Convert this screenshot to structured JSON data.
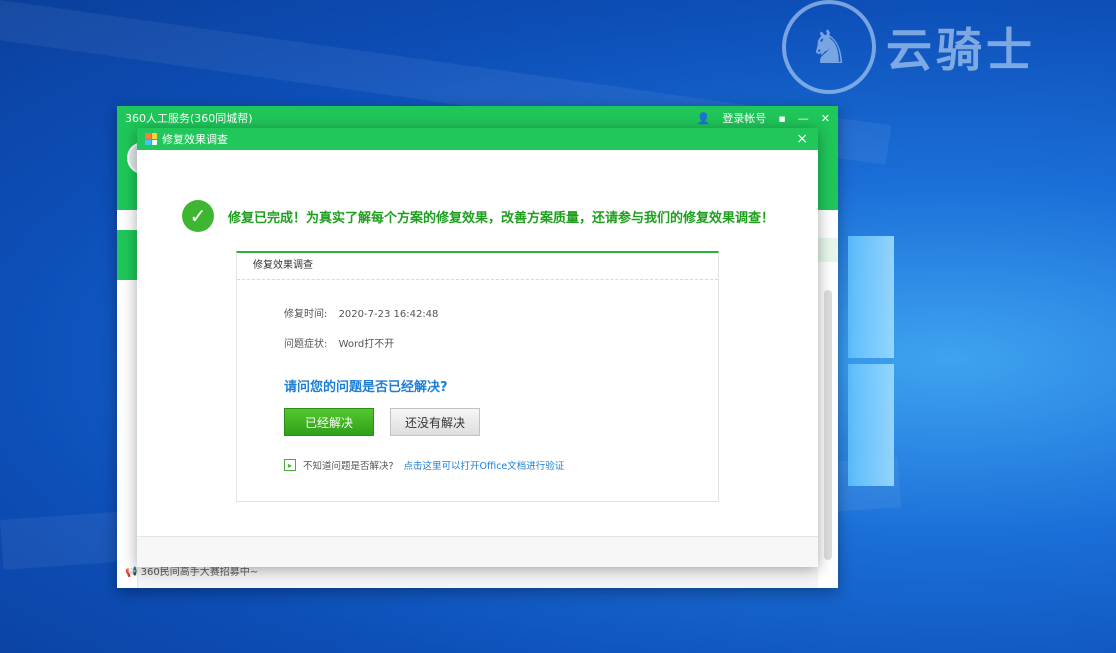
{
  "back_window": {
    "title": "360人工服务(360同城帮)",
    "login_label": "登录帐号",
    "footer_text": "360民间高手大赛招募中~"
  },
  "dialog": {
    "title": "修复效果调查",
    "close": "×",
    "headline": "修复已完成！为真实了解每个方案的修复效果，改善方案质量，还请参与我们的修复效果调查！",
    "card": {
      "header": "修复效果调查",
      "time_label": "修复时间:",
      "time_value": "2020-7-23 16:42:48",
      "symptom_label": "问题症状:",
      "symptom_value": "Word打不开",
      "question": "请问您的问题是否已经解决?",
      "resolved_button": "已经解决",
      "unresolved_button": "还没有解决",
      "hint_text": "不知道问题是否解决?",
      "hint_link": "点击这里可以打开Office文档进行验证"
    }
  },
  "watermark": {
    "text": "云骑士"
  },
  "colors": {
    "green": "#22c75b",
    "link_blue": "#1e7fd6",
    "success_green": "#3fb631"
  }
}
